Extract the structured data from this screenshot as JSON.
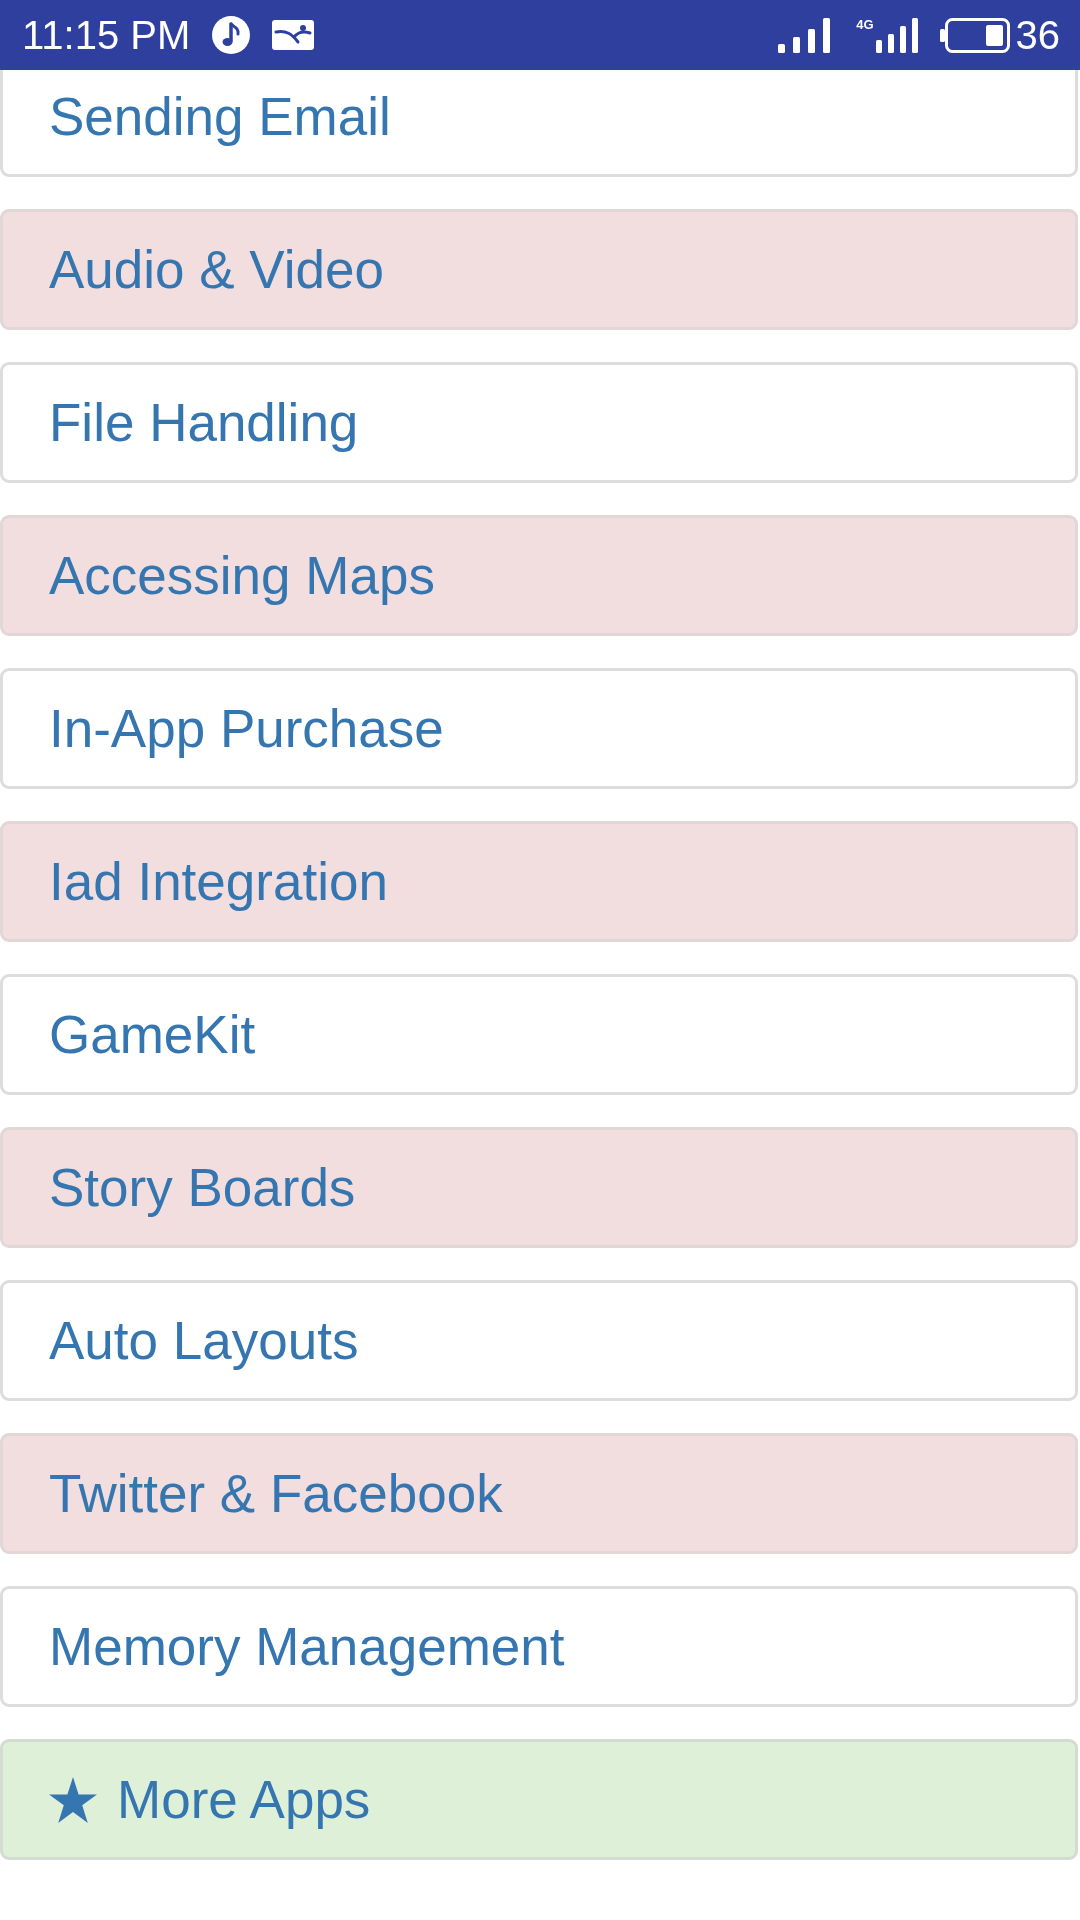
{
  "status_bar": {
    "time": "11:15 PM",
    "network_label": "4G",
    "battery_text": "36"
  },
  "items": [
    {
      "label": "Sending Email",
      "kind": "plain"
    },
    {
      "label": "Audio & Video",
      "kind": "highlight"
    },
    {
      "label": "File Handling",
      "kind": "plain"
    },
    {
      "label": "Accessing Maps",
      "kind": "highlight"
    },
    {
      "label": "In-App Purchase",
      "kind": "plain"
    },
    {
      "label": "Iad Integration",
      "kind": "highlight"
    },
    {
      "label": "GameKit",
      "kind": "plain"
    },
    {
      "label": "Story Boards",
      "kind": "highlight"
    },
    {
      "label": "Auto Layouts",
      "kind": "plain"
    },
    {
      "label": "Twitter & Facebook",
      "kind": "highlight"
    },
    {
      "label": "Memory Management",
      "kind": "plain"
    },
    {
      "label": "More Apps",
      "kind": "featured"
    }
  ]
}
